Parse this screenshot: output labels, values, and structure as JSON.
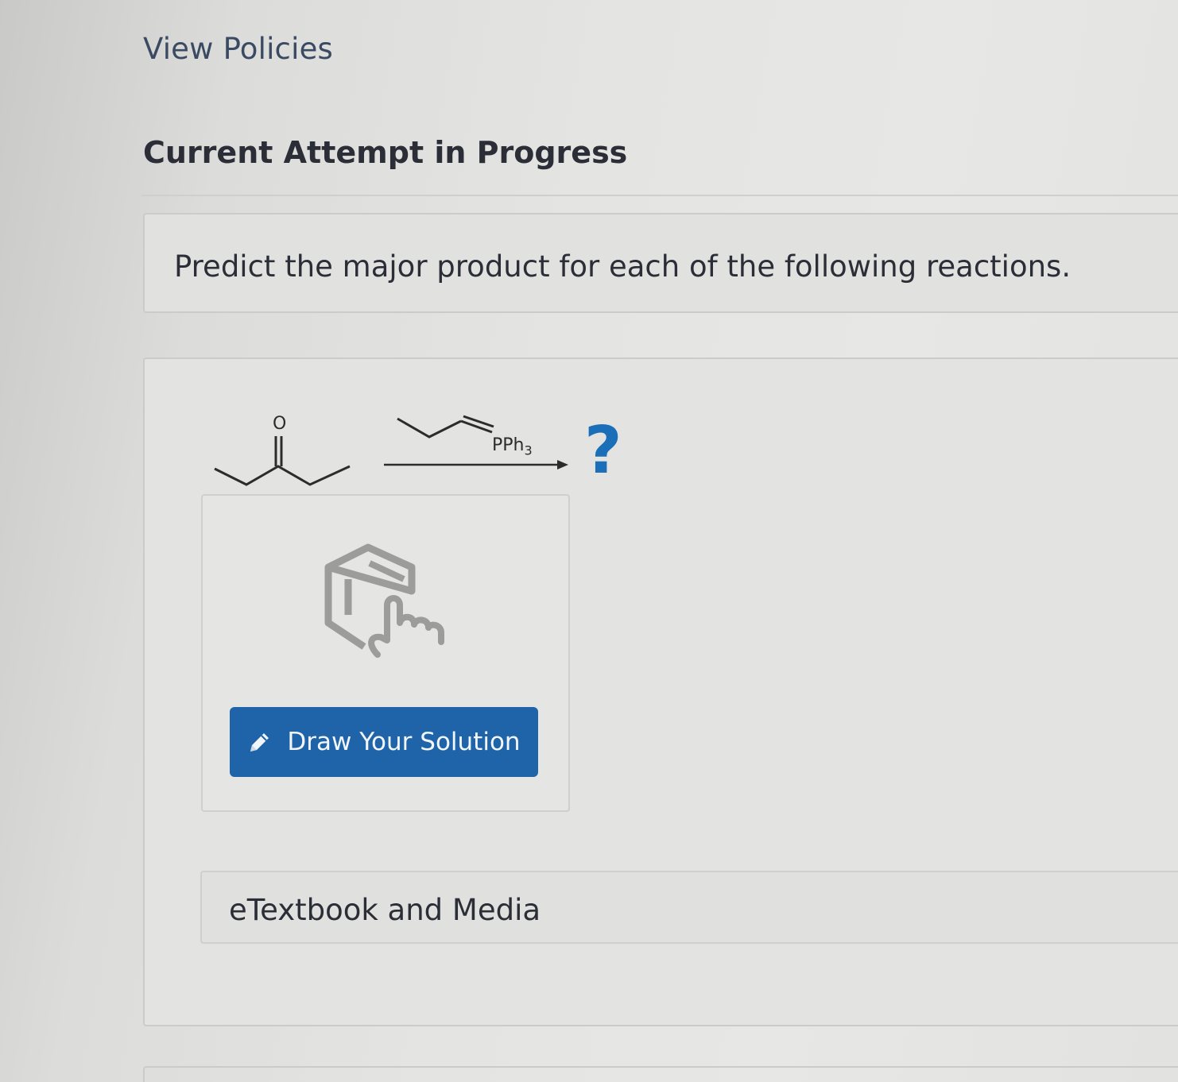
{
  "header": {
    "policies_link": "View Policies",
    "attempt_heading": "Current Attempt in Progress"
  },
  "question": {
    "prompt": "Predict the major product for each of the following reactions."
  },
  "reaction": {
    "oxygen_label": "O",
    "reagent_label_main": "PPh",
    "reagent_label_sub": "3",
    "unknown_product": "?"
  },
  "draw_panel": {
    "button_label": "Draw Your Solution",
    "button_icon": "pencil-icon",
    "placeholder_icon": "molecule-sketch-icon"
  },
  "resources": {
    "media_label": "eTextbook and Media"
  },
  "colors": {
    "accent_button": "#1f63a8",
    "question_mark": "#1a6fb8",
    "link": "#3b4a63"
  }
}
